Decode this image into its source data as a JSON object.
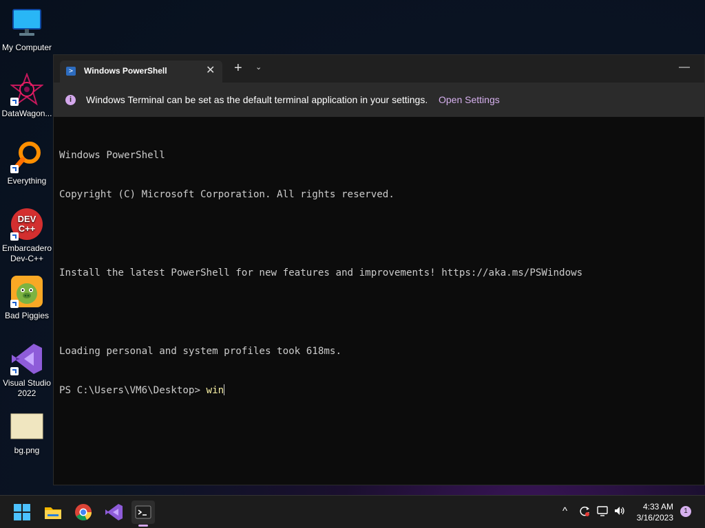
{
  "desktop": {
    "icons": [
      {
        "label": "My Computer",
        "icon": "monitor-icon"
      },
      {
        "label": "DataWagon...",
        "icon": "datawagon-icon"
      },
      {
        "label": "Everything",
        "icon": "magnifier-icon"
      },
      {
        "label": "Embarcadero Dev-C++",
        "icon": "devcpp-icon"
      },
      {
        "label": "Bad Piggies",
        "icon": "bad-piggies-icon"
      },
      {
        "label": "Visual Studio 2022",
        "icon": "visual-studio-icon"
      },
      {
        "label": "bg.png",
        "icon": "image-file-icon"
      }
    ]
  },
  "terminal": {
    "tab_title": "Windows PowerShell",
    "infobar": {
      "message": "Windows Terminal can be set as the default terminal application in your settings.",
      "link": "Open Settings"
    },
    "lines": [
      "Windows PowerShell",
      "Copyright (C) Microsoft Corporation. All rights reserved.",
      "",
      "Install the latest PowerShell for new features and improvements! https://aka.ms/PSWindows",
      "",
      "Loading personal and system profiles took 618ms."
    ],
    "prompt": "PS C:\\Users\\VM6\\Desktop> ",
    "typed": "win"
  },
  "taskbar": {
    "apps": [
      "start-icon",
      "file-explorer-icon",
      "chrome-icon",
      "visual-studio-icon",
      "terminal-icon"
    ],
    "clock_time": "4:33 AM",
    "clock_date": "3/16/2023",
    "notification_count": "1"
  },
  "colors": {
    "accent": "#d6b0ee",
    "terminal_bg": "#0c0c0c",
    "command_text": "#f9f1a5"
  }
}
